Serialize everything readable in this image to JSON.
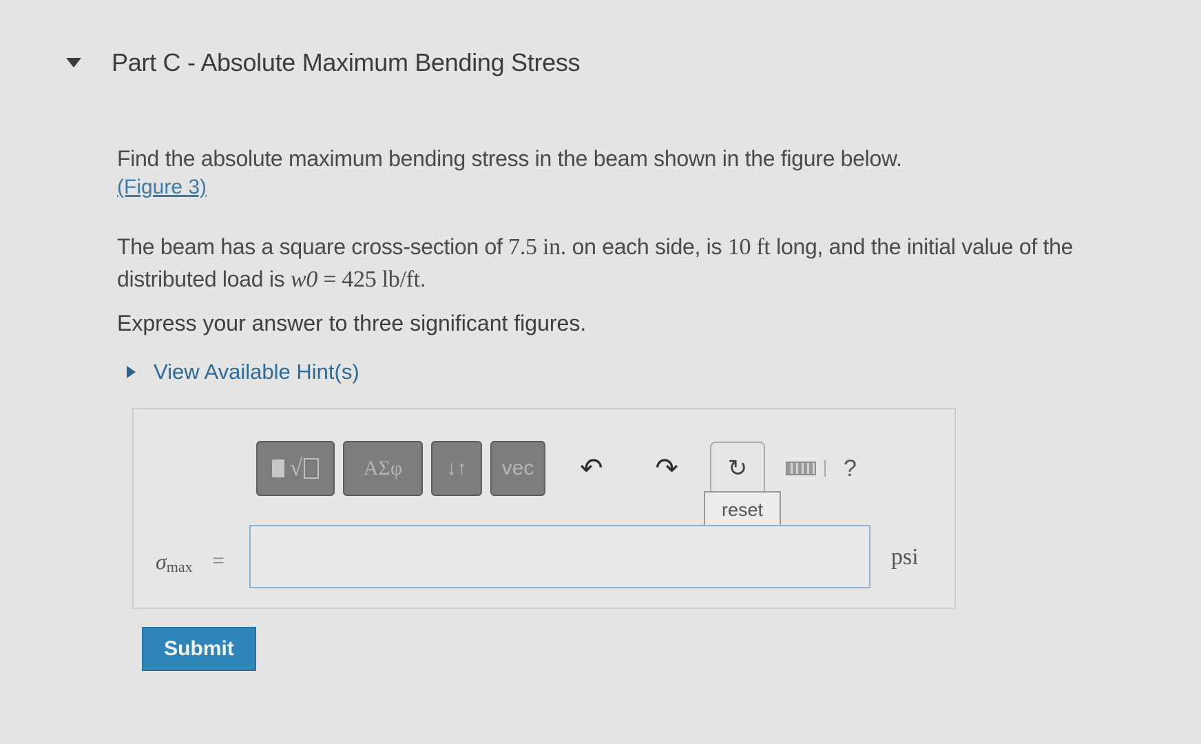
{
  "part": {
    "title": "Part C - Absolute Maximum Bending Stress"
  },
  "question": {
    "line1": "Find the absolute maximum bending stress in the beam shown in the figure below.",
    "figure_link": "(Figure 3)",
    "desc_pre": "The beam has a square cross-section of ",
    "side_value": "7.5 in.",
    "desc_mid1": " on each side, is ",
    "length_value": "10 ft",
    "desc_mid2": " long, and the initial value of the distributed load is ",
    "load_symbol": "w0",
    "load_equals": " = ",
    "load_value": "425 lb/ft",
    "desc_end": ".",
    "instructions": "Express your answer to three significant figures."
  },
  "hints": {
    "label": "View Available Hint(s)"
  },
  "toolbar": {
    "greek_label": "ΑΣφ",
    "arrows_label": "↓↑",
    "vec_label": "vec",
    "undo_glyph": "↶",
    "redo_glyph": "↷",
    "reset_glyph": "↻",
    "help_glyph": "?",
    "tooltip": "reset"
  },
  "answer": {
    "var_symbol": "σ",
    "var_sub": "max",
    "equals": "=",
    "value": "",
    "unit": "psi"
  },
  "submit_label": "Submit"
}
